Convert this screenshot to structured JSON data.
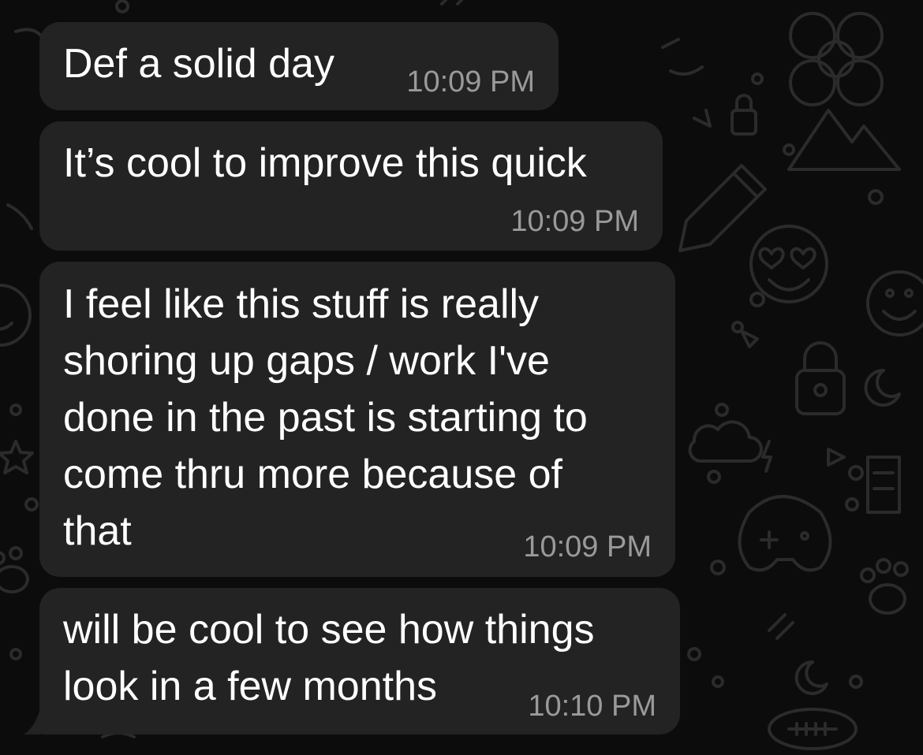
{
  "conversation": {
    "messages": [
      {
        "text": "Def a solid day",
        "time": "10:09 PM"
      },
      {
        "text": "It’s cool to improve this quick",
        "time": "10:09 PM"
      },
      {
        "text": "I feel like this stuff is really\nshoring up gaps / work I've\ndone in the past is starting to\ncome thru more because of\nthat",
        "time": "10:09 PM"
      },
      {
        "text": "will be cool to see how things\nlook in a few months",
        "time": "10:10 PM"
      }
    ]
  },
  "theme": {
    "background": "#0c0c0c",
    "bubble_incoming": "#232323",
    "text": "#ffffff",
    "timestamp": "#9a9a9a",
    "doodle": "#2a2a2a"
  },
  "wallpaper_icons": [
    "heart-icon",
    "lock-icon",
    "pencil-icon",
    "smiley-icon",
    "cloud-icon",
    "flower-icon",
    "moon-icon",
    "paw-icon",
    "mountain-icon",
    "star-icon",
    "controller-icon",
    "football-icon"
  ]
}
